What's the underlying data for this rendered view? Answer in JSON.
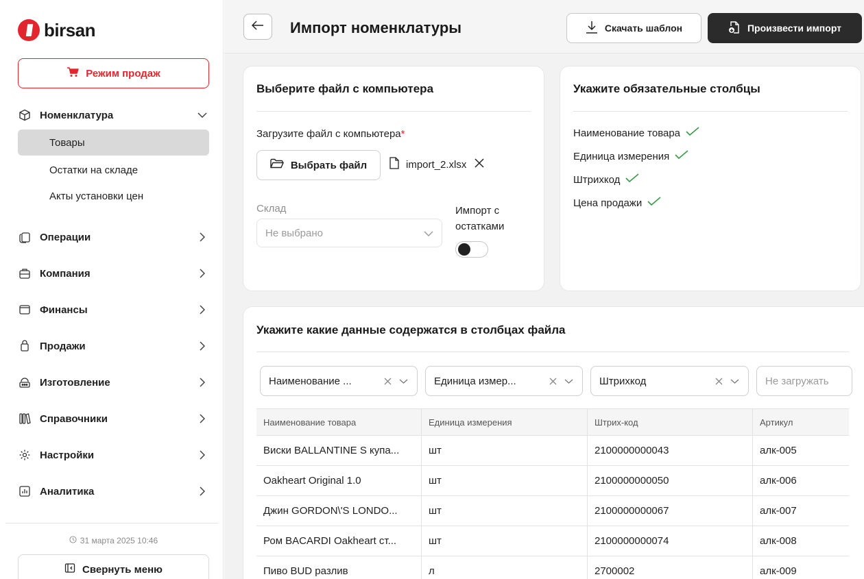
{
  "app": {
    "logo_text": "birsan"
  },
  "sidebar": {
    "sales_button": "Режим продаж",
    "sections": [
      {
        "label": "Номенклатура",
        "icon": "box-icon",
        "expanded": true,
        "items": [
          {
            "label": "Товары",
            "active": true
          },
          {
            "label": "Остатки на складе"
          },
          {
            "label": "Акты установки цен"
          }
        ]
      },
      {
        "label": "Операции",
        "icon": "operations-icon"
      },
      {
        "label": "Компания",
        "icon": "company-icon"
      },
      {
        "label": "Финансы",
        "icon": "wallet-icon"
      },
      {
        "label": "Продажи",
        "icon": "bag-icon"
      },
      {
        "label": "Изготовление",
        "icon": "production-icon"
      },
      {
        "label": "Справочники",
        "icon": "books-icon"
      },
      {
        "label": "Настройки",
        "icon": "gear-icon"
      },
      {
        "label": "Аналитика",
        "icon": "chart-icon"
      }
    ],
    "datetime": "31 марта 2025 10:46",
    "collapse_button": "Свернуть меню"
  },
  "header": {
    "title": "Импорт номенклатуры",
    "download_button": "Скачать шаблон",
    "import_button": "Произвести импорт"
  },
  "file_card": {
    "title": "Выберите файл с компьютера",
    "upload_label": "Загрузите файл с компьютера",
    "required_mark": "*",
    "choose_button": "Выбрать файл",
    "file_name": "import_2.xlsx",
    "warehouse_label": "Склад",
    "warehouse_value": "Не выбрано",
    "import_stock_label_1": "Импорт с",
    "import_stock_label_2": "остатками",
    "import_stock_enabled": false
  },
  "required_card": {
    "title": "Укажите обязательные столбцы",
    "items": [
      "Наименование товара",
      "Единица измерения",
      "Штрихкод",
      "Цена продажи"
    ]
  },
  "mapping_card": {
    "title": "Укажите какие данные содержатся в столбцах файла",
    "selectors": [
      "Наименование ...",
      "Единица измер...",
      "Штрихкод",
      "Не загружать"
    ],
    "table": {
      "headers": [
        "Наименование товара",
        "Единица измерения",
        "Штрих-код",
        "Артикул"
      ],
      "rows": [
        [
          "Виски BALLANTINE S купа...",
          "шт",
          "2100000000043",
          "алк-005"
        ],
        [
          "Oakheart Original 1.0",
          "шт",
          "2100000000050",
          "алк-006"
        ],
        [
          "Джин GORDON\\'S LONDO...",
          "шт",
          "2100000000067",
          "алк-007"
        ],
        [
          "Ром BACARDI Oakheart ст...",
          "шт",
          "2100000000074",
          "алк-008"
        ],
        [
          "Пиво BUD разлив",
          "л",
          "2700002",
          "алк-009"
        ]
      ]
    }
  },
  "colors": {
    "accent": "#e3262e",
    "dark_button": "#2b2b2b",
    "check": "#3a9a4a"
  }
}
